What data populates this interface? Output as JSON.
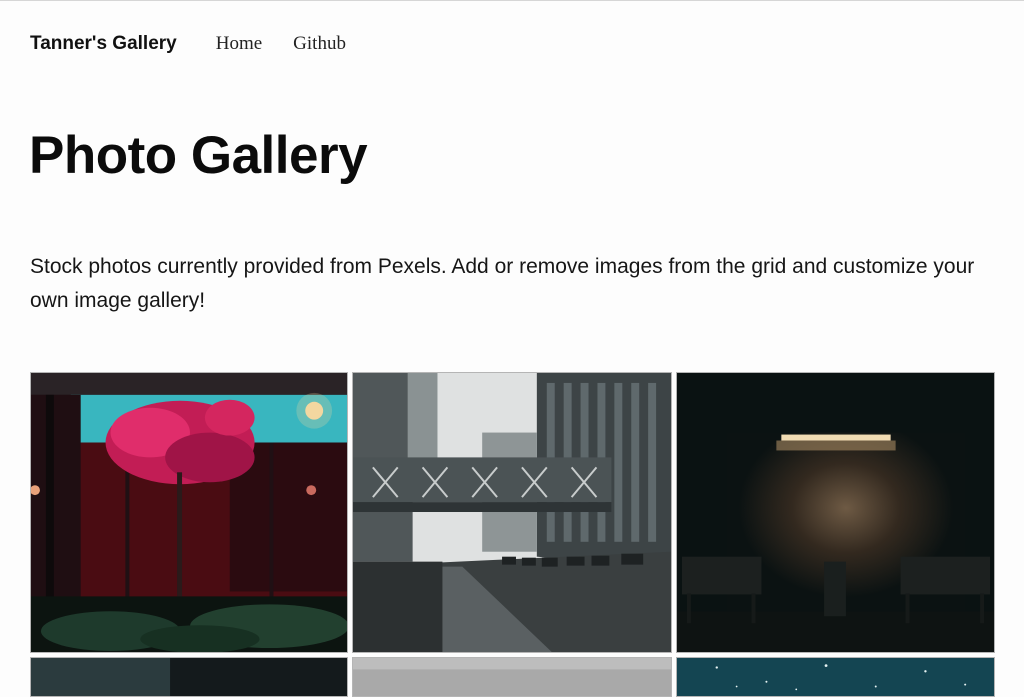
{
  "nav": {
    "brand": "Tanner's Gallery",
    "links": [
      "Home",
      "Github"
    ]
  },
  "page": {
    "title": "Photo Gallery",
    "intro": "Stock photos currently provided from Pexels. Add or remove images from the grid and customize your own image gallery!"
  },
  "gallery": {
    "photos": [
      {
        "subject": "red tree in neon-lit courtyard"
      },
      {
        "subject": "skybridge between city buildings on wet street"
      },
      {
        "subject": "dark wall lit by lamp with benches"
      },
      {
        "subject": "dark teal photo partially visible"
      },
      {
        "subject": "grey photo partially visible"
      },
      {
        "subject": "starry night sky partially visible"
      }
    ]
  }
}
